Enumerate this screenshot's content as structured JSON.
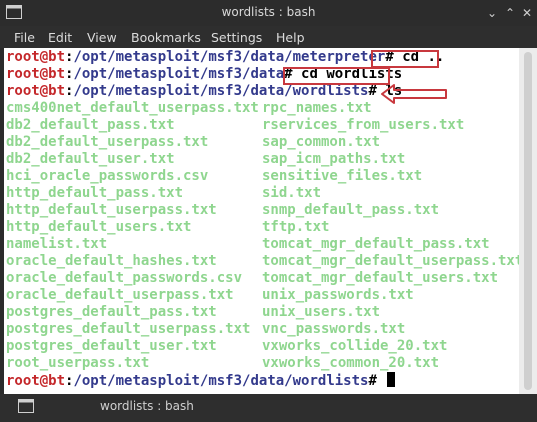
{
  "window": {
    "title": "wordlists : bash"
  },
  "menu": [
    "File",
    "Edit",
    "View",
    "Bookmarks",
    "Settings",
    "Help"
  ],
  "terminal": {
    "user_host": "root@bt",
    "lines": [
      {
        "path": "/opt/metasploit/msf3/data/meterpreter",
        "hash": "#",
        "cmd": " cd .."
      },
      {
        "path": "/opt/metasploit/msf3/data",
        "hash": "#",
        "cmd": " cd wordlists"
      },
      {
        "path": "/opt/metasploit/msf3/data/wordlists",
        "hash": "#",
        "cmd": " ls"
      }
    ],
    "files_left": [
      "cms400net_default_userpass.txt",
      "db2_default_pass.txt",
      "db2_default_userpass.txt",
      "db2_default_user.txt",
      "hci_oracle_passwords.csv",
      "http_default_pass.txt",
      "http_default_userpass.txt",
      "http_default_users.txt",
      "namelist.txt",
      "oracle_default_hashes.txt",
      "oracle_default_passwords.csv",
      "oracle_default_userpass.txt",
      "postgres_default_pass.txt",
      "postgres_default_userpass.txt",
      "postgres_default_user.txt",
      "root_userpass.txt"
    ],
    "files_right": [
      "rpc_names.txt",
      "rservices_from_users.txt",
      "sap_common.txt",
      "sap_icm_paths.txt",
      "sensitive_files.txt",
      "sid.txt",
      "snmp_default_pass.txt",
      "tftp.txt",
      "tomcat_mgr_default_pass.txt",
      "tomcat_mgr_default_userpass.txt",
      "tomcat_mgr_default_users.txt",
      "unix_passwords.txt",
      "unix_users.txt",
      "vnc_passwords.txt",
      "vxworks_collide_20.txt",
      "vxworks_common_20.txt"
    ],
    "final_prompt": {
      "path": "/opt/metasploit/msf3/data/wordlists",
      "hash": "#"
    }
  },
  "statusbar": {
    "tab_label": "wordlists : bash"
  },
  "colors": {
    "annotation": "#c8383e",
    "user": "#c4272a",
    "path": "#333a8c",
    "file": "#8fd68f"
  },
  "icons": [
    "terminal-icon",
    "minimize-icon",
    "maximize-icon",
    "close-icon",
    "tab-terminal-icon"
  ]
}
